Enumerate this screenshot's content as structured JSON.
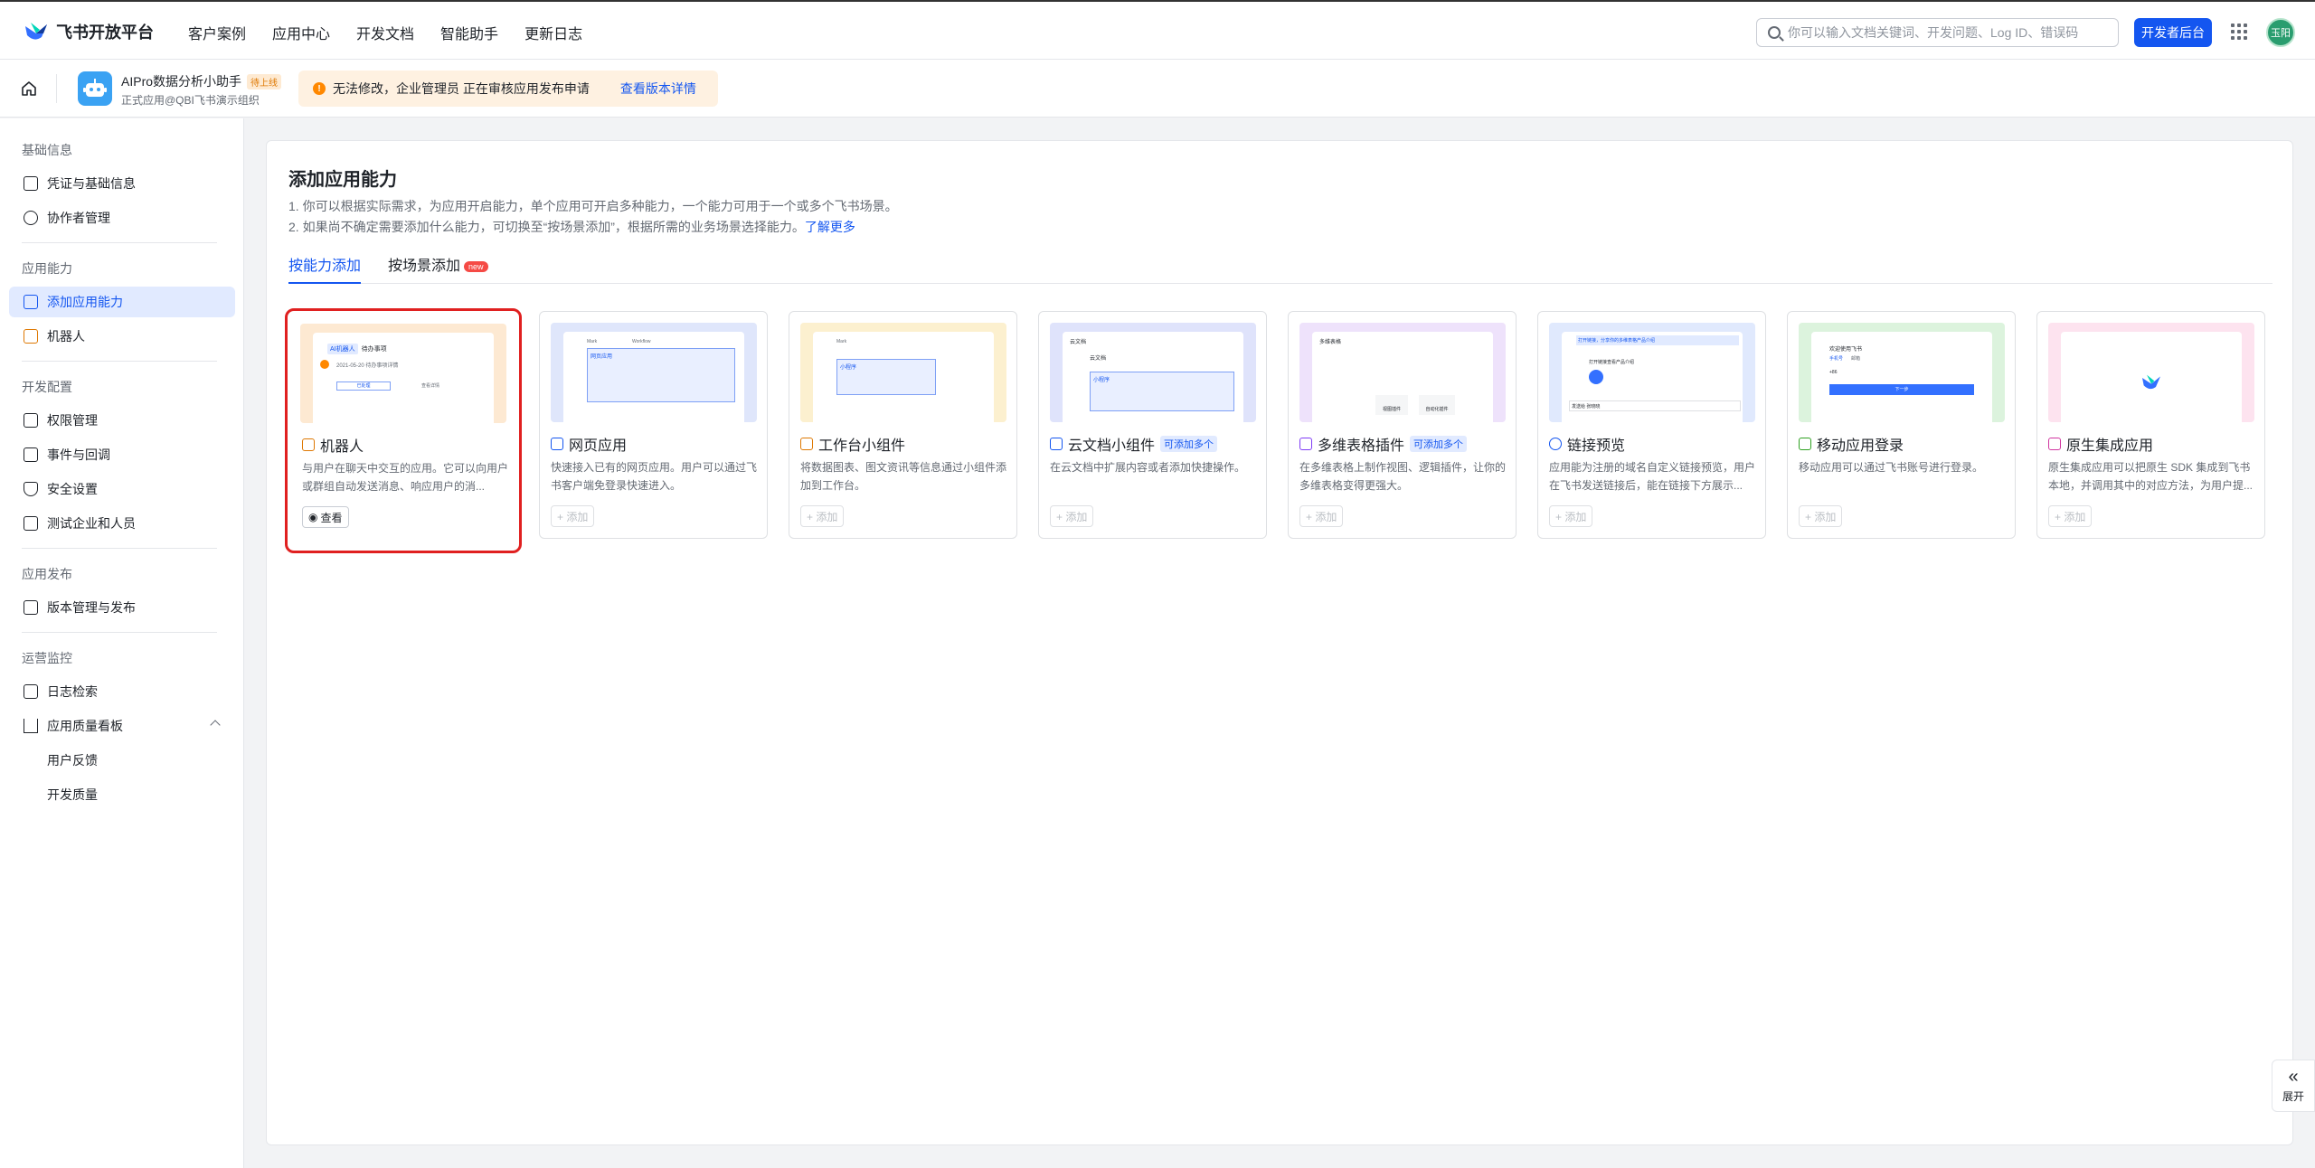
{
  "topbar": {
    "brand": "飞书开放平台",
    "nav": [
      "客户案例",
      "应用中心",
      "开发文档",
      "智能助手",
      "更新日志"
    ],
    "search_placeholder": "你可以输入文档关键词、开发问题、Log ID、错误码",
    "dev_console": "开发者后台",
    "avatar": "玉阳"
  },
  "subbar": {
    "app_name": "AIPro数据分析小助手",
    "app_tag": "待上线",
    "app_sub": "正式应用@QBI飞书演示组织",
    "notice": "无法修改，企业管理员 正在审核应用发布申请",
    "notice_link": "查看版本详情"
  },
  "sidebar": {
    "sections": [
      {
        "title": "基础信息",
        "items": [
          "凭证与基础信息",
          "协作者管理"
        ]
      },
      {
        "title": "应用能力",
        "items": [
          "添加应用能力",
          "机器人"
        ]
      },
      {
        "title": "开发配置",
        "items": [
          "权限管理",
          "事件与回调",
          "安全设置",
          "测试企业和人员"
        ]
      },
      {
        "title": "应用发布",
        "items": [
          "版本管理与发布"
        ]
      },
      {
        "title": "运营监控",
        "items": [
          "日志检索",
          "应用质量看板",
          "用户反馈",
          "开发质量"
        ]
      }
    ]
  },
  "main": {
    "title": "添加应用能力",
    "desc1": "1. 你可以根据实际需求，为应用开启能力，单个应用可开启多种能力，一个能力可用于一个或多个飞书场景。",
    "desc2": "2. 如果尚不确定需要添加什么能力，可切换至“按场景添加”，根据所需的业务场景选择能力。",
    "desc2_link": "了解更多",
    "tab_ability": "按能力添加",
    "tab_scene": "按场景添加",
    "tab_new": "new",
    "multi_label": "可添加多个",
    "add_label": "+ 添加",
    "view_label": "查看",
    "cards": [
      {
        "title": "机器人",
        "desc": "与用户在聊天中交互的应用。它可以向用户或群组自动发送消息、响应用户的消...",
        "color": "#fde9d2"
      },
      {
        "title": "网页应用",
        "desc": "快速接入已有的网页应用。用户可以通过飞书客户端免登录快速进入。",
        "color": "#dfe6fb"
      },
      {
        "title": "工作台小组件",
        "desc": "将数据图表、图文资讯等信息通过小组件添加到工作台。",
        "color": "#fcf0cf"
      },
      {
        "title": "云文档小组件",
        "desc": "在云文档中扩展内容或者添加快捷操作。",
        "color": "#dfe3fb"
      },
      {
        "title": "多维表格插件",
        "desc": "在多维表格上制作视图、逻辑插件，让你的多维表格变得更强大。",
        "color": "#eee2fb"
      },
      {
        "title": "链接预览",
        "desc": "应用能为注册的域名自定义链接预览，用户在飞书发送链接后，能在链接下方展示...",
        "color": "#e0e9fd"
      },
      {
        "title": "移动应用登录",
        "desc": "移动应用可以通过飞书账号进行登录。",
        "color": "#dcf3dd"
      },
      {
        "title": "原生集成应用",
        "desc": "原生集成应用可以把原生 SDK 集成到飞书本地，并调用其中的对应方法，为用户提...",
        "color": "#fde3ef"
      }
    ],
    "thumb_texts": {
      "bot_badge": "AI机器人",
      "bot_heading": "待办事项",
      "bot_line": "2021-05-20 待办事项详情",
      "bot_btn1": "已处理",
      "bot_btn2": "查看详情",
      "web_tab1": "Mark",
      "web_tab2": "Workflow",
      "web_box": "网页应用",
      "widget_tab": "Mark",
      "widget_box": "小程序",
      "doc_header": "云文档",
      "doc_line": "云文档",
      "doc_box": "小程序",
      "base_header": "多维表格",
      "base_chip1": "视图插件",
      "base_chip2": "自动化插件",
      "link_msg": "打开链接，分享你的多维表格产品介绍",
      "link_card": "打开链接查看产品介绍",
      "link_input": "发送给 张晓晓",
      "login_title": "欢迎使用飞书",
      "login_tab1": "手机号",
      "login_tab2": "邮箱",
      "login_code": "+86",
      "login_btn": "下一步"
    }
  },
  "expand": "展开"
}
